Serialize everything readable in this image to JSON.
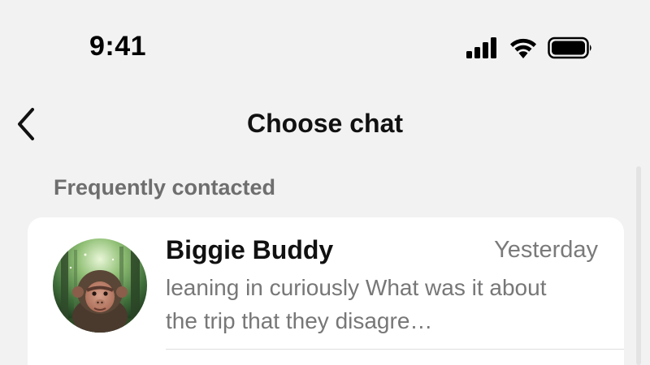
{
  "status_bar": {
    "time": "9:41",
    "icons": [
      "cellular-signal-icon",
      "wifi-icon",
      "battery-icon"
    ]
  },
  "nav": {
    "back_icon": "chevron-left-icon",
    "title": "Choose chat"
  },
  "section": {
    "label": "Frequently contacted"
  },
  "chats": [
    {
      "name": "Biggie Buddy",
      "time": "Yesterday",
      "preview": "leaning in curiously What was it about the trip that they disagre…",
      "avatar": "monkey-avatar"
    }
  ],
  "colors": {
    "background": "#f2f2f2",
    "card": "#ffffff",
    "title": "#111111",
    "secondary_text": "#777777",
    "section_label": "#6e6e6e"
  }
}
